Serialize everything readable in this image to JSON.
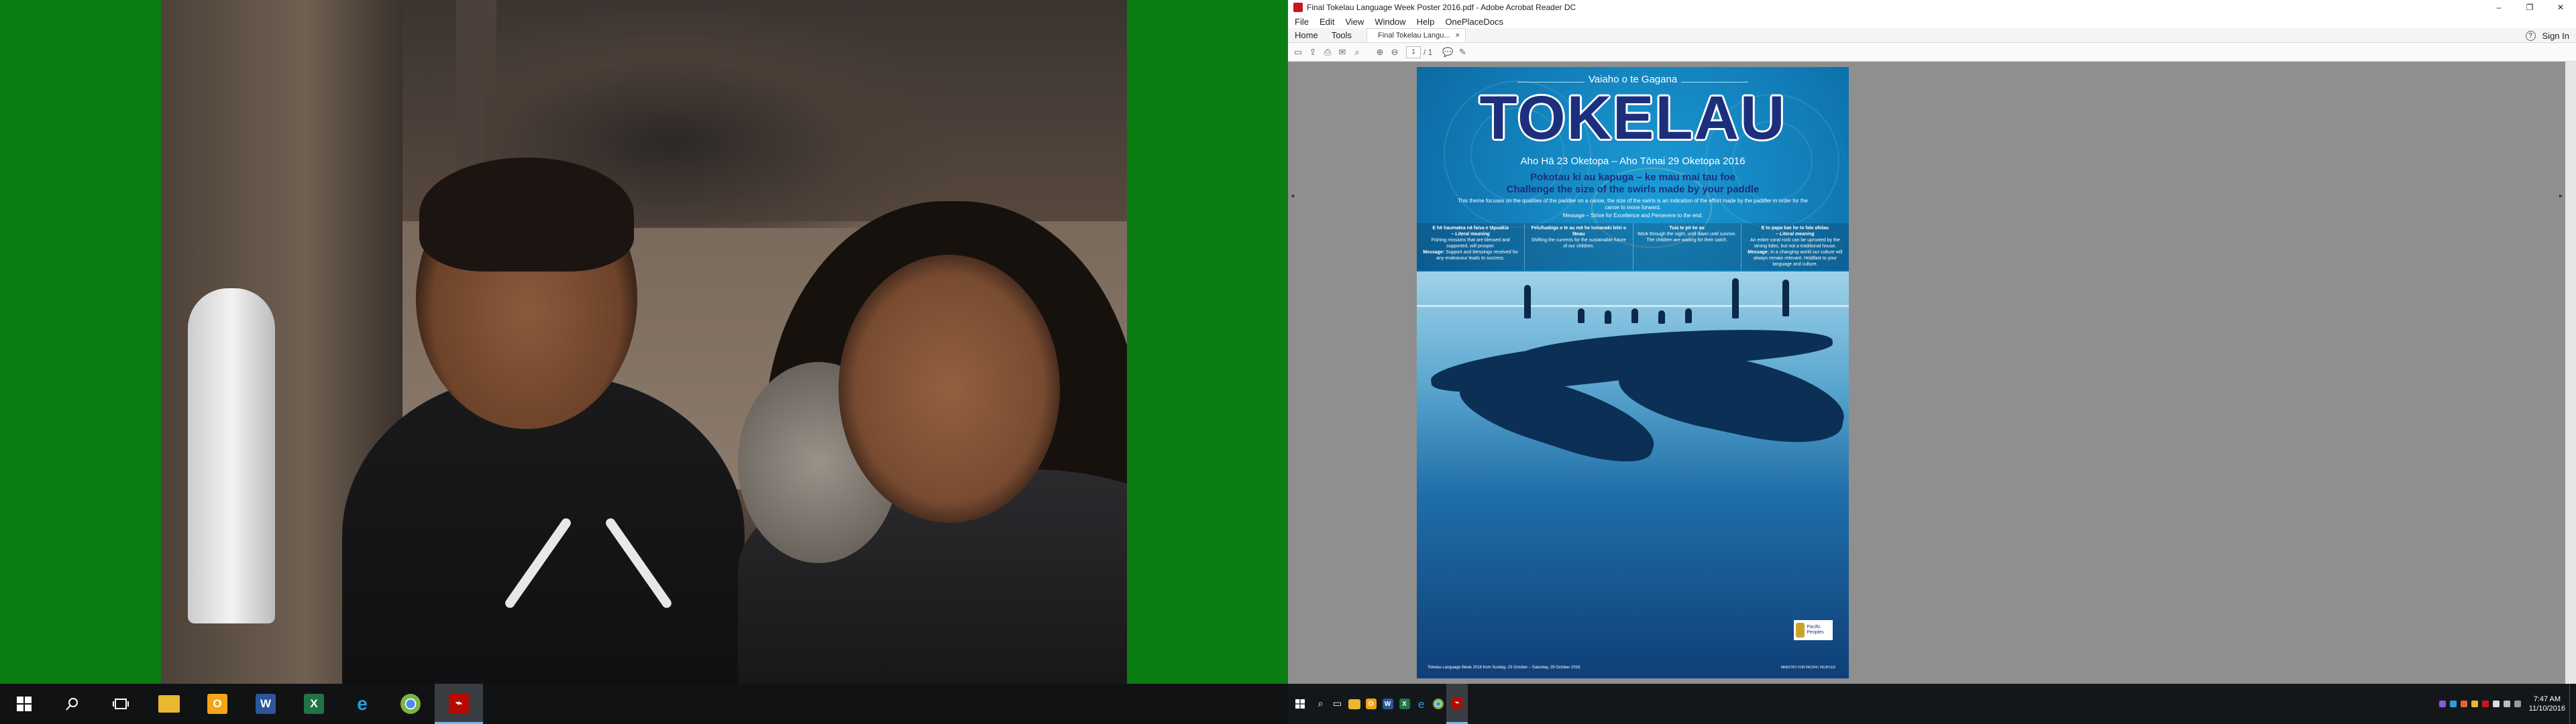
{
  "left_monitor": {
    "wallpaper": "photo of two smiling children in a shopping street",
    "taskbar": {
      "icons": [
        "windows-start-icon",
        "search-icon",
        "task-view-icon",
        "file-explorer-icon",
        "outlook-icon",
        "word-icon",
        "excel-icon",
        "edge-icon",
        "chrome-icon",
        "acrobat-icon"
      ],
      "labels": {
        "word": "W",
        "excel": "X",
        "outlook": "O"
      }
    }
  },
  "acrobat": {
    "window_title": "Final Tokelau Language Week Poster 2016.pdf - Adobe Acrobat Reader DC",
    "window_controls": {
      "minimize": "–",
      "maximize": "❐",
      "close": "✕"
    },
    "menu": [
      "File",
      "Edit",
      "View",
      "Window",
      "Help",
      "OnePlaceDocs"
    ],
    "nav_tabs": [
      "Home",
      "Tools"
    ],
    "doc_tab": "Final Tokelau Langu...",
    "doc_tab_close": "×",
    "help_label": "?",
    "sign_in": "Sign In",
    "page_current": "1",
    "page_total": "/ 1",
    "toolbar_icons": [
      "save-icon",
      "upload-icon",
      "print-icon",
      "email-icon",
      "zoom-search-icon",
      "page-up-icon",
      "page-down-icon",
      "comment-icon",
      "sign-pen-icon"
    ]
  },
  "poster": {
    "subtitle": "Vaiaho o te Gagana",
    "title": "TOKELAU",
    "dates": "Aho Hā 23 Oketopa – Aho Tōnai 29 Oketopa 2016",
    "theme_tokelauan": "Pokotau ki au kapuga – ke mau mai tau foe",
    "theme_english": "Challenge the size of the swirls made by your paddle",
    "description": "This theme focuses on the qualities of the paddler on a canoe, the size of the swirls is an indication of the effort made by the paddler in order for the canoe to move forward.",
    "message": "Message – Strive for Excellence and Persevere to the end.",
    "columns": [
      {
        "heading": "E hē haumatea nā faiva e tāpuakia",
        "literal": "– Literal meaning",
        "body1": "Fishing missions that are blessed and supported, will prosper.",
        "msg_label": "Message:",
        "body2": "Support and blessings received for any endeavour leads to success."
      },
      {
        "heading": "Felulluakiga o te au mō he lumanaki lelei o fānau",
        "literal": "",
        "body1": "Shifting the currents for the sustainable future of our children.",
        "msg_label": "",
        "body2": ""
      },
      {
        "heading": "Tuia te pō ke ao",
        "literal": "",
        "body1": "Work through the night, until dawn until sunrise. The children are waiting for their catch.",
        "msg_label": "",
        "body2": ""
      },
      {
        "heading": "E to papa kae he to fale afolau",
        "literal": "– Literal meaning",
        "body1": "An entire coral rock can be uprooted by the strong tides, but not a traditional house.",
        "msg_label": "Message:",
        "body2": "In a changing world our culture will always remain relevant. Holdfast to your language and culture."
      }
    ],
    "footer_left": "Tokelau Language Week 2016 from Sunday, 23 October – Saturday, 29 October 2016",
    "footer_right": "MINISTRY FOR PACIFIC PEOPLES",
    "logo_text": "Pacific Peoples"
  },
  "right_taskbar": {
    "icons": [
      "windows-start-icon",
      "search-icon",
      "task-view-icon",
      "file-explorer-icon",
      "outlook-icon",
      "word-icon",
      "excel-icon",
      "edge-icon",
      "chrome-icon",
      "acrobat-icon"
    ],
    "clock_time": "7:47 AM",
    "clock_date": "11/10/2016"
  }
}
